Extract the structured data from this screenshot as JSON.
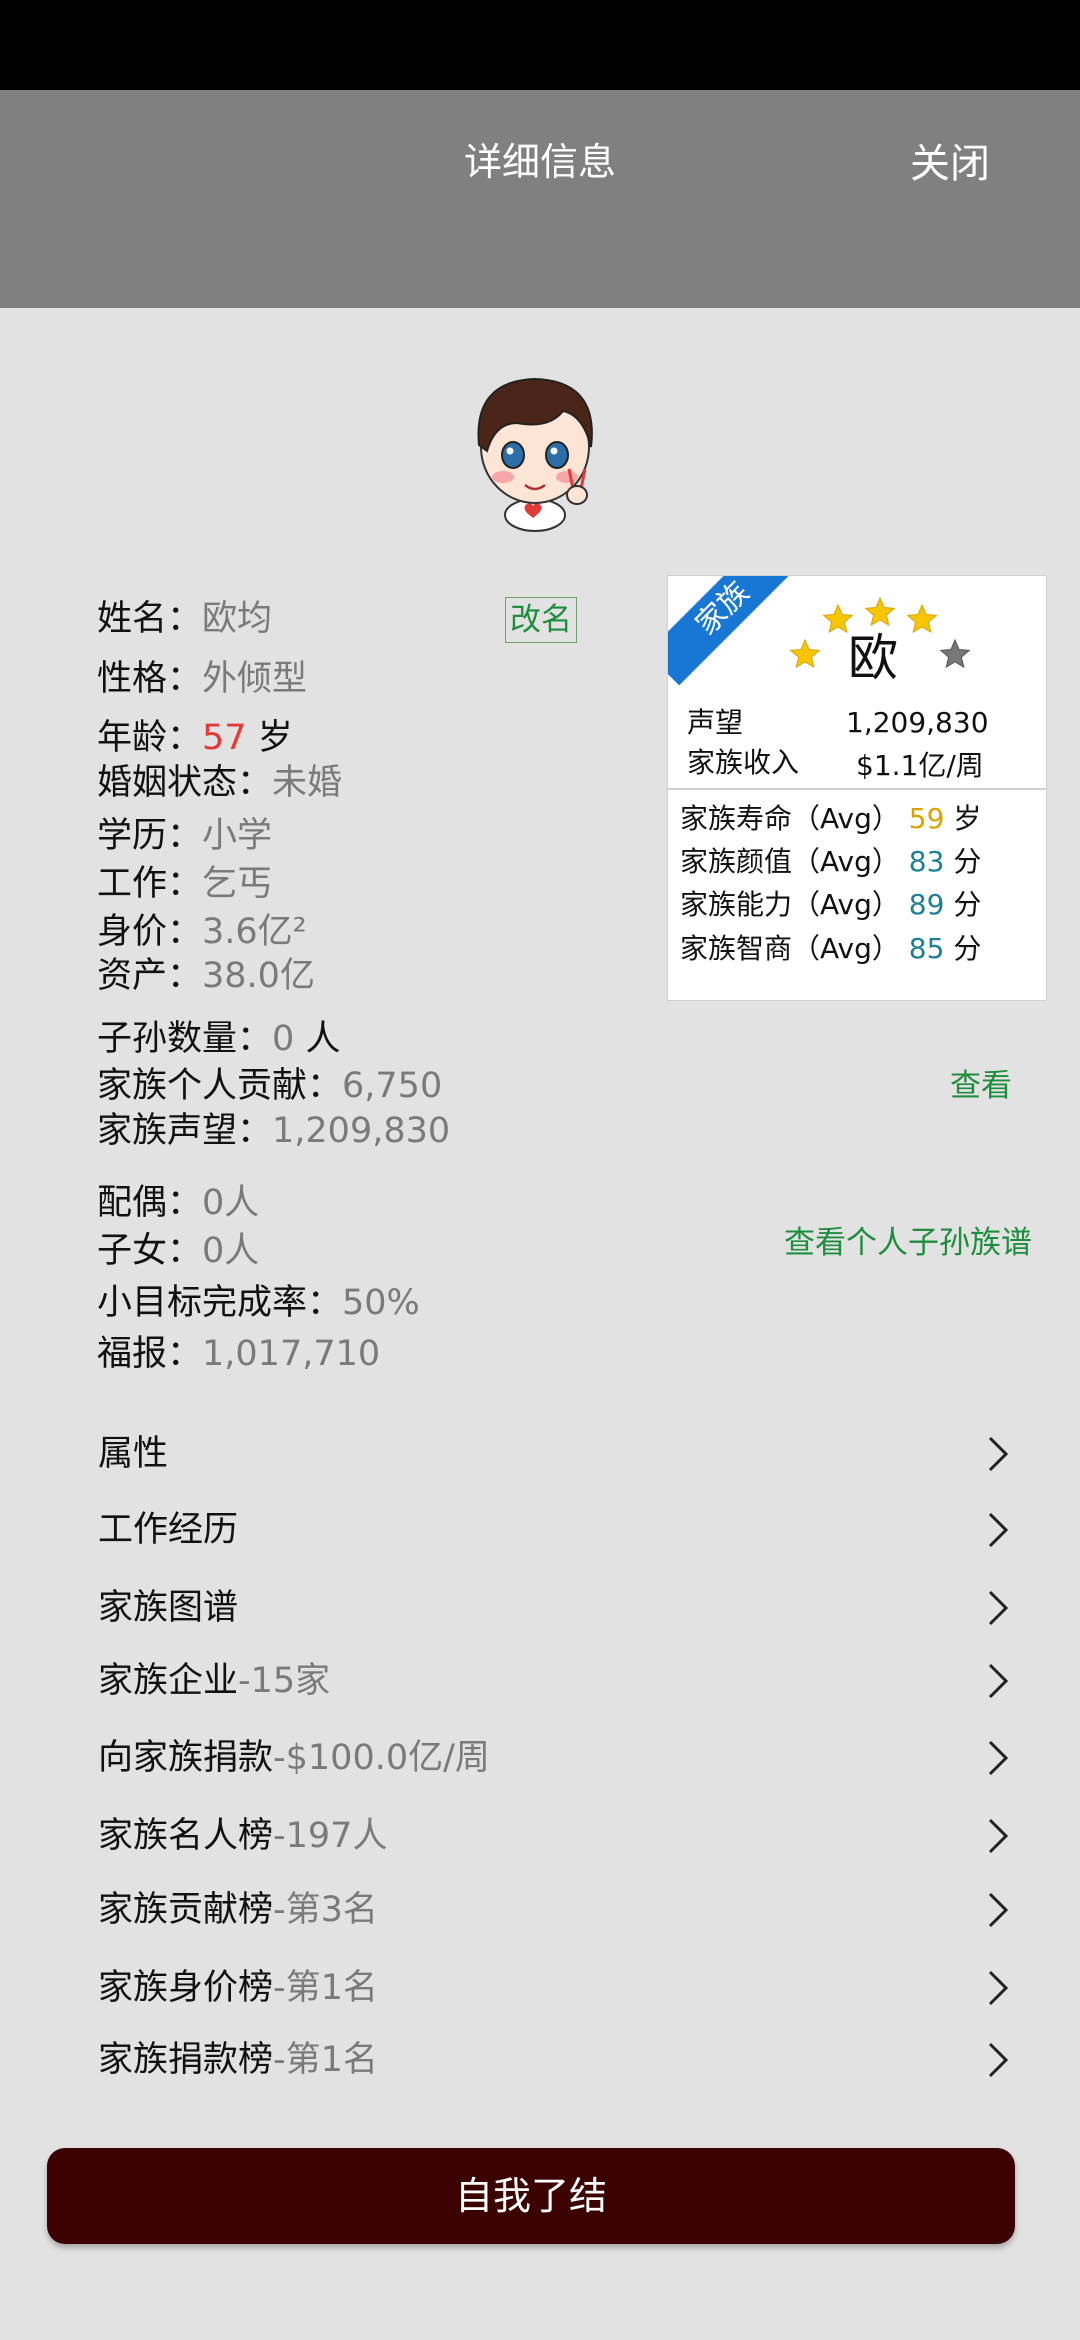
{
  "header": {
    "title": "详细信息",
    "close_label": "关闭"
  },
  "profile": {
    "name_label": "姓名：",
    "name": "欧均",
    "rename_label": "改名",
    "personality_label": "性格：",
    "personality": "外倾型",
    "age_label": "年龄：",
    "age": "57",
    "age_unit": "岁",
    "marital_label": "婚姻状态：",
    "marital": "未婚",
    "education_label": "学历：",
    "education": "小学",
    "job_label": "工作：",
    "job": "乞丐",
    "worth_label": "身价：",
    "worth": "3.6亿²",
    "assets_label": "资产：",
    "assets": "38.0亿",
    "descendants_label": "子孙数量：",
    "descendants": "0",
    "descendants_unit": "人",
    "contribution_label": "家族个人贡献：",
    "contribution": "6,750",
    "view_label": "查看",
    "prestige_label": "家族声望：",
    "prestige": "1,209,830",
    "spouse_label": "配偶：",
    "spouse": "0人",
    "children_label": "子女：",
    "children": "0人",
    "tree_link": "查看个人子孙族谱",
    "goal_label": "小目标完成率：",
    "goal": "50%",
    "fortune_label": "福报：",
    "fortune": "1,017,710"
  },
  "family_card": {
    "ribbon": "家族",
    "surname": "欧",
    "stars_filled": 4,
    "stars_total": 5,
    "prestige_label": "声望",
    "prestige": "1,209,830",
    "income_label": "家族收入",
    "income": "$1.1亿/周",
    "lifespan_label": "家族寿命（Avg）",
    "lifespan": "59",
    "lifespan_unit": "岁",
    "looks_label": "家族颜值（Avg）",
    "looks": "83",
    "looks_unit": "分",
    "ability_label": "家族能力（Avg）",
    "ability": "89",
    "ability_unit": "分",
    "iq_label": "家族智商（Avg）",
    "iq": "85",
    "iq_unit": "分"
  },
  "menu": [
    {
      "label": "属性",
      "suffix": ""
    },
    {
      "label": "工作经历",
      "suffix": ""
    },
    {
      "label": "家族图谱",
      "suffix": ""
    },
    {
      "label": "家族企业",
      "suffix": "-15家"
    },
    {
      "label": "向家族捐款",
      "suffix": "-$100.0亿/周"
    },
    {
      "label": "家族名人榜",
      "suffix": "-197人"
    },
    {
      "label": "家族贡献榜",
      "suffix": "-第3名"
    },
    {
      "label": "家族身价榜",
      "suffix": "-第1名"
    },
    {
      "label": "家族捐款榜",
      "suffix": "-第1名"
    }
  ],
  "end_button": "自我了结",
  "colors": {
    "header": "#808080",
    "end_button": "#3c0202",
    "accent_green": "#1e8e3e",
    "ribbon": "#1877d4"
  }
}
